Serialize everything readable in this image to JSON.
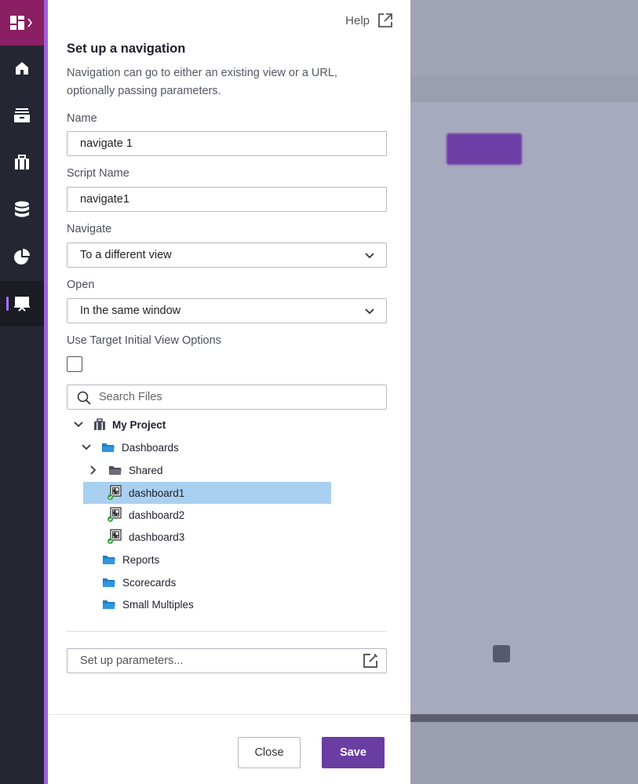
{
  "panel": {
    "help_label": "Help",
    "title": "Set up a navigation",
    "description": "Navigation can go to either an existing view or a URL, optionally passing parameters.",
    "name_label": "Name",
    "name_value": "navigate 1",
    "script_label": "Script Name",
    "script_value": "navigate1",
    "navigate_label": "Navigate",
    "navigate_value": "To a different view",
    "open_label": "Open",
    "open_value": "In the same window",
    "target_label": "Use Target Initial View Options",
    "search_placeholder": "Search Files",
    "params_placeholder": "Set up parameters...",
    "close_label": "Close",
    "save_label": "Save"
  },
  "tree": {
    "project": "My Project",
    "dashboards": "Dashboards",
    "shared": "Shared",
    "dashboard1": "dashboard1",
    "dashboard2": "dashboard2",
    "dashboard3": "dashboard3",
    "reports": "Reports",
    "scorecards": "Scorecards",
    "small_multiples": "Small Multiples"
  },
  "colors": {
    "accent": "#6a3da2",
    "rail": "#262633",
    "rail_top": "#8a1f63",
    "selection": "#a9d0f0"
  },
  "icons": [
    "dashboard-grid-icon",
    "home-icon",
    "archive-icon",
    "briefcase-icon",
    "database-icon",
    "pie-chart-icon",
    "presentation-icon",
    "external-link-icon",
    "chevron-down-icon",
    "search-icon",
    "folder-icon",
    "dashboard-file-icon",
    "edit-icon"
  ]
}
